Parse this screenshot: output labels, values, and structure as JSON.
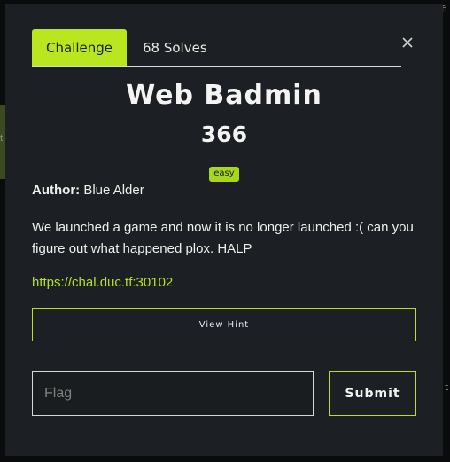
{
  "background": {
    "top_right_text": "fi",
    "right_text": "t",
    "left_text": "t"
  },
  "modal": {
    "tabs": [
      {
        "label": "Challenge",
        "active": true
      },
      {
        "label": "68 Solves",
        "active": false
      }
    ],
    "close_icon": "close-icon",
    "title": "Web Badmin",
    "value": "366",
    "difficulty": "easy",
    "author_label": "Author:",
    "author_name": "Blue Alder",
    "description": "We launched a game and now it is no longer launched :( can you figure out what happened plox. HALP",
    "link": "https://chal.duc.tf:30102",
    "hint_label": "View Hint",
    "flag_placeholder": "Flag",
    "flag_value": "",
    "submit_label": "Submit"
  },
  "colors": {
    "accent": "#b9e61e",
    "modal_bg": "#1c1f23",
    "text": "#eef0ec"
  }
}
